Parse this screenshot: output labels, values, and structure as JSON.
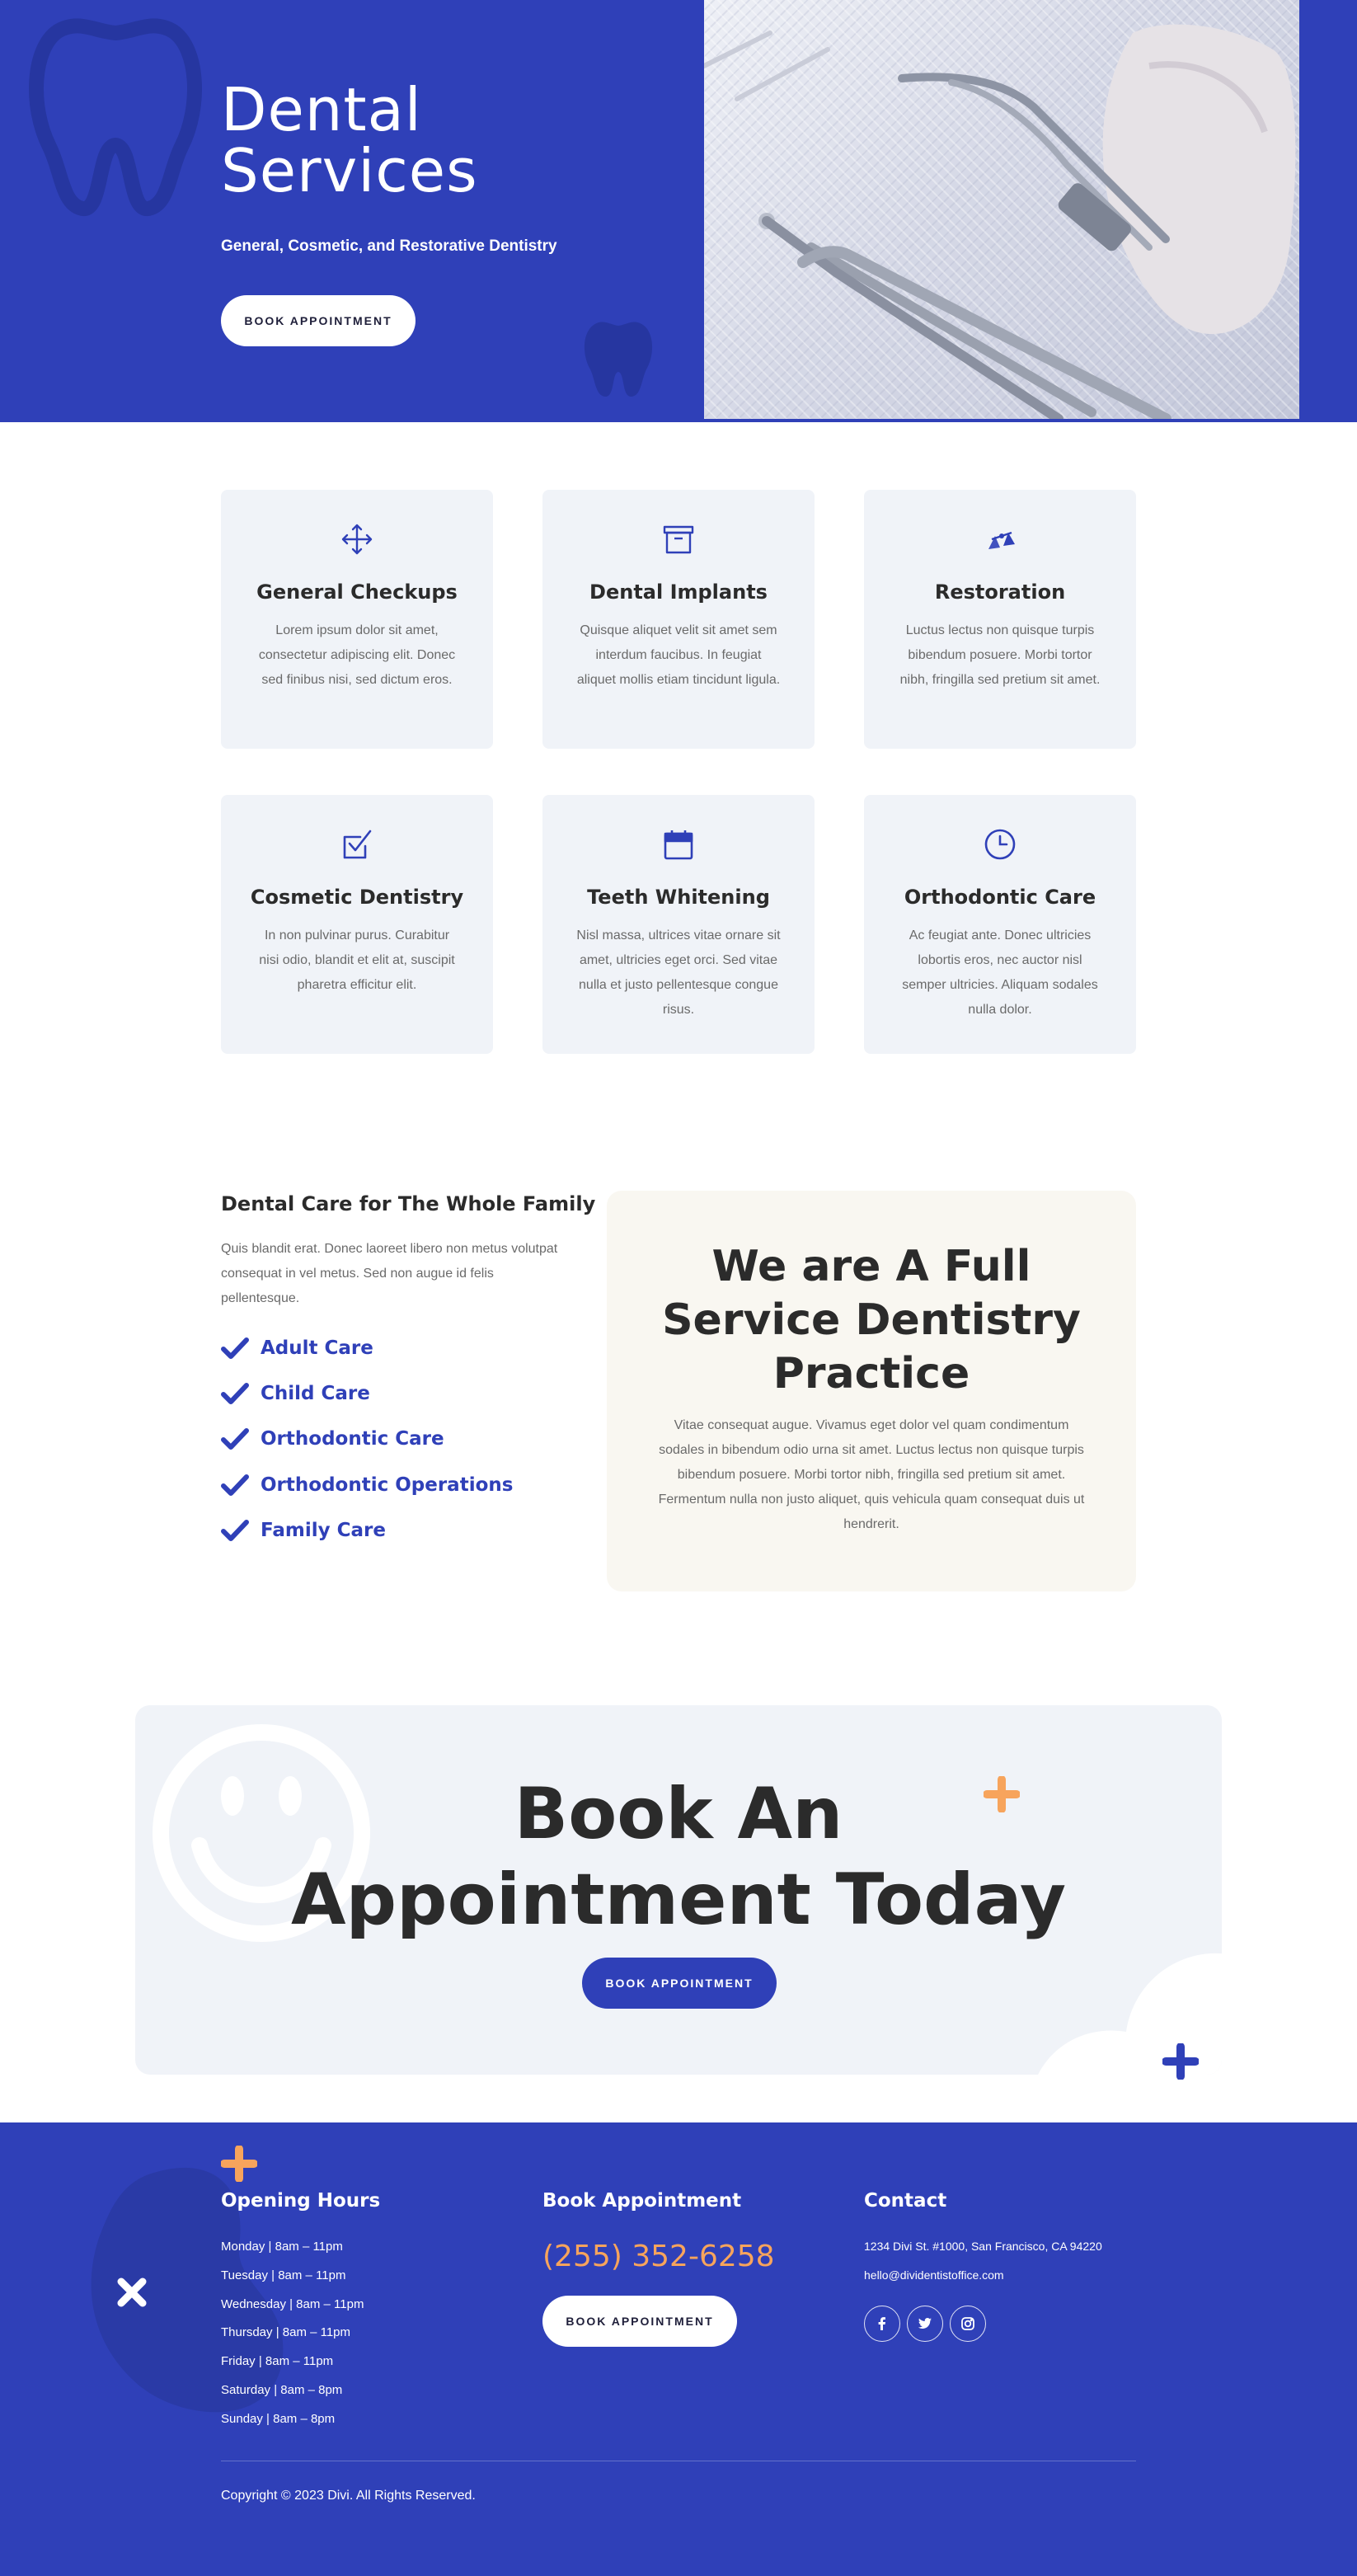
{
  "colors": {
    "brand_blue": "#2f40b8",
    "accent_orange": "#f7a45c",
    "card_bg": "#f0f3f8",
    "cream_bg": "#f9f7f1"
  },
  "hero": {
    "title": "Dental Services",
    "subtitle": "General, Cosmetic, and Restorative Dentistry",
    "button_label": "BOOK APPOINTMENT",
    "photo": "dental-instruments-photo"
  },
  "services": [
    {
      "icon": "arrows-move-icon",
      "title": "General Checkups",
      "text": "Lorem ipsum dolor sit amet, consectetur adipiscing elit. Donec sed finibus nisi, sed dictum eros."
    },
    {
      "icon": "archive-box-icon",
      "title": "Dental Implants",
      "text": "Quisque aliquet velit sit amet sem interdum faucibus. In feugiat aliquet mollis etiam tincidunt ligula."
    },
    {
      "icon": "scale-balance-icon",
      "title": "Restoration",
      "text": "Luctus lectus non quisque turpis bibendum posuere. Morbi tortor nibh, fringilla sed pretium sit amet."
    },
    {
      "icon": "checkbox-icon",
      "title": "Cosmetic Dentistry",
      "text": "In non pulvinar purus. Curabitur nisi odio, blandit et elit at, suscipit pharetra efficitur elit."
    },
    {
      "icon": "calendar-icon",
      "title": "Teeth Whitening",
      "text": "Nisl massa, ultrices vitae ornare sit amet, ultricies eget orci. Sed vitae nulla et justo pellentesque congue risus."
    },
    {
      "icon": "clock-icon",
      "title": "Orthodontic Care",
      "text": "Ac feugiat ante. Donec ultricies lobortis eros, nec auctor nisl semper ultricies. Aliquam sodales nulla dolor."
    }
  ],
  "family": {
    "title": "Dental Care for The Whole Family",
    "text": "Quis blandit erat. Donec laoreet libero non metus volutpat consequat in vel metus. Sed non augue id felis pellentesque.",
    "items": [
      "Adult Care",
      "Child Care",
      "Orthodontic Care",
      "Orthodontic Operations",
      "Family Care"
    ]
  },
  "full_service": {
    "title": "We are A Full Service Dentistry Practice",
    "text": "Vitae consequat augue. Vivamus eget dolor vel quam condimentum sodales in bibendum odio urna sit amet. Luctus lectus non quisque turpis bibendum posuere. Morbi tortor nibh, fringilla sed pretium sit amet. Fermentum nulla non justo aliquet, quis vehicula quam consequat duis ut hendrerit."
  },
  "cta": {
    "title_line1": "Book An",
    "title_line2": "Appointment Today",
    "button_label": "BOOK APPOINTMENT"
  },
  "footer": {
    "hours_title": "Opening Hours",
    "hours": [
      "Monday | 8am – 11pm",
      "Tuesday | 8am – 11pm",
      "Wednesday | 8am – 11pm",
      "Thursday | 8am – 11pm",
      "Friday | 8am – 11pm",
      "Saturday | 8am – 8pm",
      "Sunday | 8am – 8pm"
    ],
    "book_title": "Book Appointment",
    "phone": "(255) 352-6258",
    "book_button": "BOOK APPOINTMENT",
    "contact_title": "Contact",
    "address": "1234 Divi St. #1000, San Francisco, CA 94220",
    "email": "hello@dividentistoffice.com",
    "social": [
      "facebook-icon",
      "twitter-icon",
      "instagram-icon"
    ],
    "copyright": "Copyright © 2023 Divi. All Rights Reserved."
  }
}
